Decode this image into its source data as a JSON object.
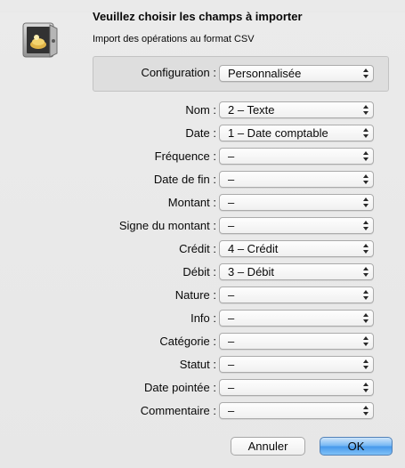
{
  "dialog": {
    "title": "Veuillez choisir les champs à importer",
    "subtitle": "Import des opérations au format CSV",
    "icon": "safe-with-gold-icon"
  },
  "configuration": {
    "label": "Configuration :",
    "value": "Personnalisée"
  },
  "fields": [
    {
      "label": "Nom :",
      "value": "2 – Texte"
    },
    {
      "label": "Date :",
      "value": "1 – Date comptable"
    },
    {
      "label": "Fréquence :",
      "value": "–"
    },
    {
      "label": "Date de fin :",
      "value": "–"
    },
    {
      "label": "Montant :",
      "value": "–"
    },
    {
      "label": "Signe du montant :",
      "value": "–"
    },
    {
      "label": "Crédit :",
      "value": "4 – Crédit"
    },
    {
      "label": "Débit :",
      "value": "3 – Débit"
    },
    {
      "label": "Nature :",
      "value": "–"
    },
    {
      "label": "Info :",
      "value": "–"
    },
    {
      "label": "Catégorie :",
      "value": "–"
    },
    {
      "label": "Statut :",
      "value": "–"
    },
    {
      "label": "Date pointée :",
      "value": "–"
    },
    {
      "label": "Commentaire :",
      "value": "–"
    }
  ],
  "buttons": {
    "cancel": "Annuler",
    "ok": "OK"
  },
  "colors": {
    "sheet_bg": "#ececec",
    "default_button": "#3f95ec"
  }
}
